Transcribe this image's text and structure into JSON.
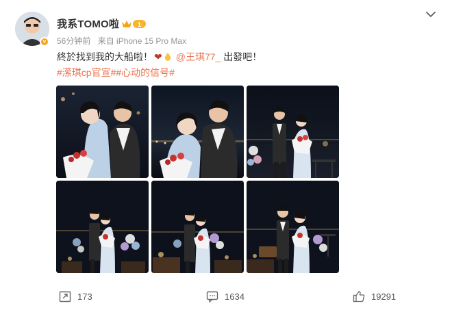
{
  "author": {
    "name": "我系TOMO啦",
    "vip_level": "1",
    "post_time": "56分钟前",
    "source": "来自 iPhone 15 Pro Max"
  },
  "post": {
    "text_main": "終於找到我的大船啦！",
    "heart": "❤",
    "mention": "@王琪77_",
    "text_end": "出發吧！",
    "tags": [
      "#潆琪cp官宣#",
      "#心动的信号#"
    ]
  },
  "photos": [
    {
      "scene": "couple-closeup-night"
    },
    {
      "scene": "couple-closeup-city-lights"
    },
    {
      "scene": "couple-standing-balloons"
    },
    {
      "scene": "couple-kiss-balloons"
    },
    {
      "scene": "couple-kiss-wide"
    },
    {
      "scene": "couple-standing-wide"
    }
  ],
  "actions": {
    "repost_count": "173",
    "comment_count": "1634",
    "like_count": "19291"
  },
  "colors": {
    "accent": "#eb7350",
    "meta_gray": "#939393",
    "vip_gold": "#f7a21b"
  }
}
